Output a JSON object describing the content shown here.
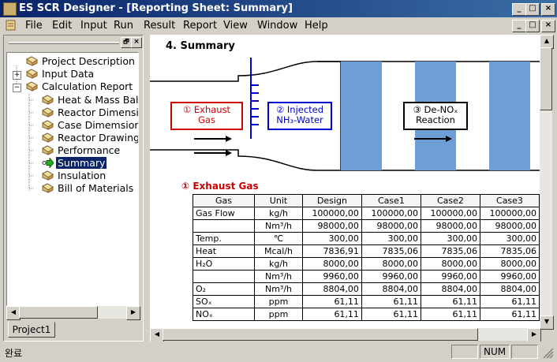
{
  "window": {
    "title": "ES SCR Designer - [Reporting Sheet: Summary]"
  },
  "window_buttons": {
    "minimize": "_",
    "restore": "□",
    "close": "×",
    "inner_restore": "🗗"
  },
  "menu": [
    {
      "label": "File"
    },
    {
      "label": "Edit"
    },
    {
      "label": "Input"
    },
    {
      "label": "Run"
    },
    {
      "label": "Result"
    },
    {
      "label": "Report"
    },
    {
      "label": "View"
    },
    {
      "label": "Window"
    },
    {
      "label": "Help"
    }
  ],
  "tree": {
    "items": [
      {
        "label": "Project Description"
      },
      {
        "label": "Input Data"
      },
      {
        "label": "Calculation Report"
      },
      {
        "label": "Heat & Mass Bal"
      },
      {
        "label": "Reactor Dimensic"
      },
      {
        "label": "Case Dimemsion"
      },
      {
        "label": "Reactor Drawing"
      },
      {
        "label": "Performance"
      },
      {
        "label": "Summary"
      },
      {
        "label": "Insulation"
      },
      {
        "label": "Bill of Materials"
      }
    ],
    "tab": "Project1"
  },
  "report": {
    "heading": "4. Summary",
    "diagram": {
      "box1_l1": "① Exhaust",
      "box1_l2": "Gas",
      "box2_l1": "② Injected",
      "box2_l2": "NH₃-Water",
      "box3_l1": "③ De-NOₓ",
      "box3_l2": "Reaction"
    },
    "section_title": "① Exhaust Gas",
    "table": {
      "headers": [
        "Gas",
        "Unit",
        "Design",
        "Case1",
        "Case2",
        "Case3"
      ],
      "rows": [
        {
          "gas": "Gas Flow",
          "unit": "kg/h",
          "vals": [
            "100000,00",
            "100000,00",
            "100000,00",
            "100000,00"
          ]
        },
        {
          "gas": "",
          "unit": "Nm³/h",
          "vals": [
            "98000,00",
            "98000,00",
            "98000,00",
            "98000,00"
          ]
        },
        {
          "gas": "Temp.",
          "unit": "℃",
          "vals": [
            "300,00",
            "300,00",
            "300,00",
            "300,00"
          ]
        },
        {
          "gas": "Heat",
          "unit": "Mcal/h",
          "vals": [
            "7836,91",
            "7835,06",
            "7835,06",
            "7835,06"
          ]
        },
        {
          "gas": "H₂O",
          "unit": "kg/h",
          "vals": [
            "8000,00",
            "8000,00",
            "8000,00",
            "8000,00"
          ]
        },
        {
          "gas": "",
          "unit": "Nm³/h",
          "vals": [
            "9960,00",
            "9960,00",
            "9960,00",
            "9960,00"
          ]
        },
        {
          "gas": "O₂",
          "unit": "Nm³/h",
          "vals": [
            "8804,00",
            "8804,00",
            "8804,00",
            "8804,00"
          ]
        },
        {
          "gas": "SOₓ",
          "unit": "ppm",
          "vals": [
            "61,11",
            "61,11",
            "61,11",
            "61,11"
          ]
        },
        {
          "gas": "NOₓ",
          "unit": "ppm",
          "vals": [
            "61,11",
            "61,11",
            "61,11",
            "61,11"
          ]
        }
      ]
    }
  },
  "status": {
    "left": "완료",
    "num": "NUM"
  },
  "colors": {
    "title_bar": "#0a246a",
    "selection": "#0a246a",
    "catalyst": "#6d9fd6",
    "exhaust_box": "#cc0000",
    "injection": "#0000cc",
    "section_title": "#cc0000"
  },
  "icons": [
    "doc-folder-icon",
    "green-arrow-icon",
    "plus-box-icon",
    "minus-box-icon"
  ]
}
